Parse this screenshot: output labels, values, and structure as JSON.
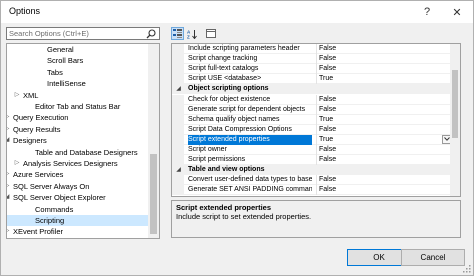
{
  "window": {
    "title": "Options"
  },
  "title_buttons": {
    "help": "?",
    "close": "✕"
  },
  "search": {
    "placeholder": "Search Options (Ctrl+E)"
  },
  "tree": {
    "items": [
      {
        "label": "General",
        "expander": ""
      },
      {
        "label": "Scroll Bars",
        "expander": ""
      },
      {
        "label": "Tabs",
        "expander": ""
      },
      {
        "label": "IntelliSense",
        "expander": ""
      },
      {
        "label": "XML",
        "expander": "▷"
      },
      {
        "label": "Editor Tab and Status Bar",
        "expander": ""
      },
      {
        "label": "Query Execution",
        "expander": "▷"
      },
      {
        "label": "Query Results",
        "expander": "▷"
      },
      {
        "label": "Designers",
        "expander": "◢"
      },
      {
        "label": "Table and Database Designers",
        "expander": ""
      },
      {
        "label": "Analysis Services Designers",
        "expander": "▷"
      },
      {
        "label": "Azure Services",
        "expander": "▷"
      },
      {
        "label": "SQL Server Always On",
        "expander": "▷"
      },
      {
        "label": "SQL Server Object Explorer",
        "expander": "◢"
      },
      {
        "label": "Commands",
        "expander": ""
      },
      {
        "label": "Scripting",
        "expander": ""
      },
      {
        "label": "XEvent Profiler",
        "expander": "▷"
      }
    ]
  },
  "toolbar": {
    "categorized_icon": "categorized-icon",
    "alphabetical_icon": "alphabetical-icon",
    "pages_icon": "property-pages-icon"
  },
  "grid": {
    "rows": [
      {
        "type": "prop",
        "name": "Include scripting parameters header",
        "value": "False"
      },
      {
        "type": "prop",
        "name": "Script change tracking",
        "value": "False"
      },
      {
        "type": "prop",
        "name": "Script full-text catalogs",
        "value": "False"
      },
      {
        "type": "prop",
        "name": "Script USE <database>",
        "value": "True"
      },
      {
        "type": "category",
        "name": "Object scripting options",
        "expander": "◢"
      },
      {
        "type": "prop",
        "name": "Check for object existence",
        "value": "False"
      },
      {
        "type": "prop",
        "name": "Generate script for dependent objects",
        "value": "False"
      },
      {
        "type": "prop",
        "name": "Schema qualify object names",
        "value": "True"
      },
      {
        "type": "prop",
        "name": "Script Data Compression Options",
        "value": "False"
      },
      {
        "type": "prop",
        "name": "Script extended properties",
        "value": "True",
        "selected": true
      },
      {
        "type": "prop",
        "name": "Script owner",
        "value": "False"
      },
      {
        "type": "prop",
        "name": "Script permissions",
        "value": "False"
      },
      {
        "type": "category",
        "name": "Table and view options",
        "expander": "◢"
      },
      {
        "type": "prop",
        "name": "Convert user-defined data types to base",
        "value": "False"
      },
      {
        "type": "prop",
        "name": "Generate SET ANSI PADDING commands",
        "value": "False"
      }
    ]
  },
  "description": {
    "title": "Script extended properties",
    "text": "Include script to set extended properties."
  },
  "buttons": {
    "ok": "OK",
    "cancel": "Cancel"
  }
}
